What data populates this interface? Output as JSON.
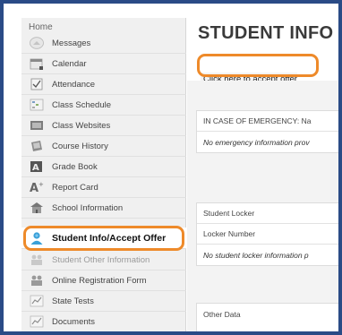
{
  "sidebar": {
    "home_label": "Home",
    "items": [
      {
        "label": "Messages",
        "icon": "messages-icon"
      },
      {
        "label": "Calendar",
        "icon": "calendar-icon"
      },
      {
        "label": "Attendance",
        "icon": "attendance-icon"
      },
      {
        "label": "Class Schedule",
        "icon": "class-schedule-icon"
      },
      {
        "label": "Class Websites",
        "icon": "class-websites-icon"
      },
      {
        "label": "Course History",
        "icon": "course-history-icon"
      },
      {
        "label": "Grade Book",
        "icon": "grade-book-icon"
      },
      {
        "label": "Report Card",
        "icon": "report-card-icon"
      },
      {
        "label": "School Information",
        "icon": "school-information-icon"
      },
      {
        "label": "Student Info/Accept Offer",
        "icon": "student-info-icon"
      },
      {
        "label": "Student Other Information",
        "icon": "student-other-info-icon"
      },
      {
        "label": "Online Registration Form",
        "icon": "online-registration-icon"
      },
      {
        "label": "State Tests",
        "icon": "state-tests-icon"
      },
      {
        "label": "Documents",
        "icon": "documents-icon"
      }
    ]
  },
  "main": {
    "title": "STUDENT INFO",
    "accept_button": "Click here to accept offer",
    "emergency": {
      "header": "IN CASE OF EMERGENCY: Na",
      "empty": "No emergency information prov"
    },
    "locker": {
      "header": "Student Locker",
      "column": "Locker Number",
      "empty": "No student locker information p"
    },
    "other": {
      "header": "Other Data"
    }
  },
  "colors": {
    "highlight": "#ee8a2a",
    "frame": "#2a4b86",
    "student_icon": "#3aa0d8"
  }
}
